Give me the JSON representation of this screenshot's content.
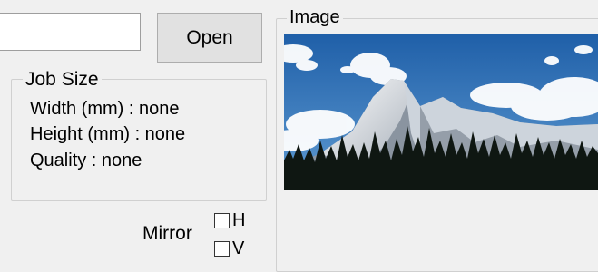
{
  "path": {
    "value": ""
  },
  "open_button": {
    "label": "Open"
  },
  "job_size": {
    "title": "Job Size",
    "width_line": "Width (mm) : none",
    "height_line": "Height (mm) : none",
    "quality_line": "Quality : none"
  },
  "mirror": {
    "label": "Mirror",
    "h_label": "H",
    "v_label": "V",
    "h_checked": false,
    "v_checked": false
  },
  "image_panel": {
    "title": "Image"
  },
  "colors": {
    "window_bg": "#f0f0f0",
    "button_bg": "#e1e1e1",
    "sky": "#2f6fb4"
  }
}
